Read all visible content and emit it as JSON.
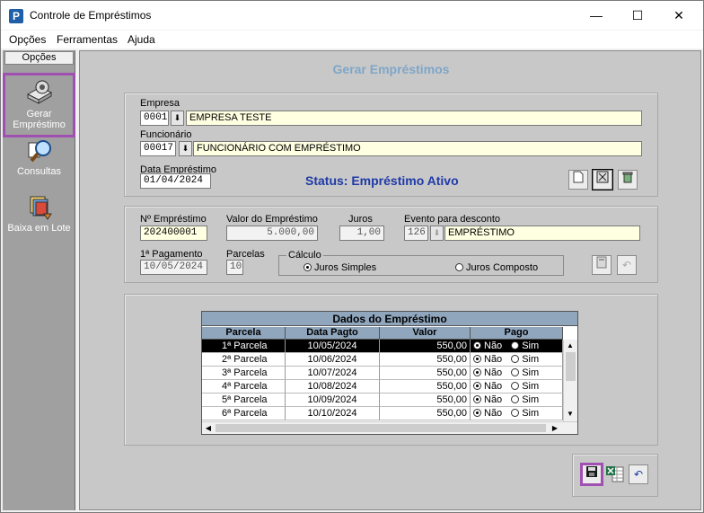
{
  "window": {
    "title": "Controle de Empréstimos",
    "minimize": "—",
    "maximize": "☐",
    "close": "✕",
    "app_icon": "P"
  },
  "menu": [
    "Opções",
    "Ferramentas",
    "Ajuda"
  ],
  "sidebar": {
    "header": "Opções",
    "items": [
      {
        "label1": "Gerar",
        "label2": "Empréstimo",
        "icon": "money-gear-icon"
      },
      {
        "label1": "Consultas",
        "label2": "",
        "icon": "magnifier-icon"
      },
      {
        "label1": "Baixa em Lote",
        "label2": "",
        "icon": "batch-icon"
      }
    ]
  },
  "page": {
    "heading": "Gerar Empréstimos"
  },
  "empresa": {
    "label": "Empresa",
    "code": "0001",
    "name": "EMPRESA TESTE"
  },
  "funcionario": {
    "label": "Funcionário",
    "code": "00017",
    "name": "FUNCIONÁRIO COM EMPRÉSTIMO"
  },
  "data_emprestimo": {
    "label": "Data Empréstimo",
    "value": "01/04/2024"
  },
  "status": "Status: Empréstimo Ativo",
  "loan": {
    "numero_label": "Nº Empréstimo",
    "numero": "202400001",
    "valor_label": "Valor do Empréstimo",
    "valor": "5.000,00",
    "juros_label": "Juros",
    "juros": "1,00",
    "evento_label": "Evento para desconto",
    "evento_code": "126",
    "evento_name": "EMPRÉSTIMO",
    "pagamento_label": "1ª Pagamento",
    "pagamento": "10/05/2024",
    "parcelas_label": "Parcelas",
    "parcelas": "10",
    "calculo_label": "Cálculo",
    "juros_simples": "Juros Simples",
    "juros_composto": "Juros Composto"
  },
  "grid": {
    "title": "Dados do Empréstimo",
    "headers": [
      "Parcela",
      "Data Pagto",
      "Valor",
      "Pago"
    ],
    "opt_nao": "Não",
    "opt_sim": "Sim",
    "rows": [
      {
        "parcela": "1ª Parcela",
        "data": "10/05/2024",
        "valor": "550,00"
      },
      {
        "parcela": "2ª Parcela",
        "data": "10/06/2024",
        "valor": "550,00"
      },
      {
        "parcela": "3ª Parcela",
        "data": "10/07/2024",
        "valor": "550,00"
      },
      {
        "parcela": "4ª Parcela",
        "data": "10/08/2024",
        "valor": "550,00"
      },
      {
        "parcela": "5ª Parcela",
        "data": "10/09/2024",
        "valor": "550,00"
      },
      {
        "parcela": "6ª Parcela",
        "data": "10/10/2024",
        "valor": "550,00"
      }
    ]
  },
  "colors": {
    "heading": "#7fa6c8",
    "status": "#1f3aa8",
    "grid_header": "#8fa6bd",
    "highlight": "#a050b0"
  }
}
